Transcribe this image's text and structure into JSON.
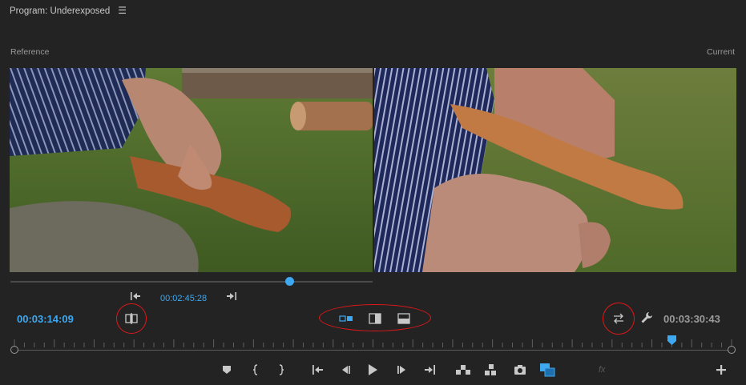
{
  "panel": {
    "title": "Program: Underexposed",
    "menu_icon": "hamburger-menu-icon"
  },
  "comparison": {
    "reference_label": "Reference",
    "current_label": "Current",
    "reference_timecode": "00:02:45:28",
    "reference_scrubber_position": 0.77
  },
  "timecodes": {
    "playhead": "00:03:14:09",
    "duration": "00:03:30:43"
  },
  "timeline": {
    "playhead_position": 0.918
  },
  "colors": {
    "accent": "#3ea8f0",
    "highlight_circle": "#e01818",
    "background": "#232323"
  },
  "icons": {
    "go_to_in": "go-to-in-point-icon",
    "go_to_out": "go-to-out-point-icon",
    "shot_frame_compare": "shot-or-frame-compare-icon",
    "side_by_side": "side-by-side-icon",
    "vertical_split": "vertical-split-icon",
    "horizontal_split": "horizontal-split-icon",
    "swap_sides": "swap-sides-icon",
    "settings": "wrench-icon",
    "fx": "fx"
  },
  "transport": [
    "add-marker-icon",
    "mark-in-icon",
    "mark-out-icon",
    "go-to-in-icon",
    "step-back-icon",
    "play-icon",
    "step-forward-icon",
    "go-to-out-icon",
    "lift-icon",
    "extract-icon",
    "export-frame-icon",
    "comparison-view-icon",
    "fx-icon",
    "add-button-icon"
  ]
}
